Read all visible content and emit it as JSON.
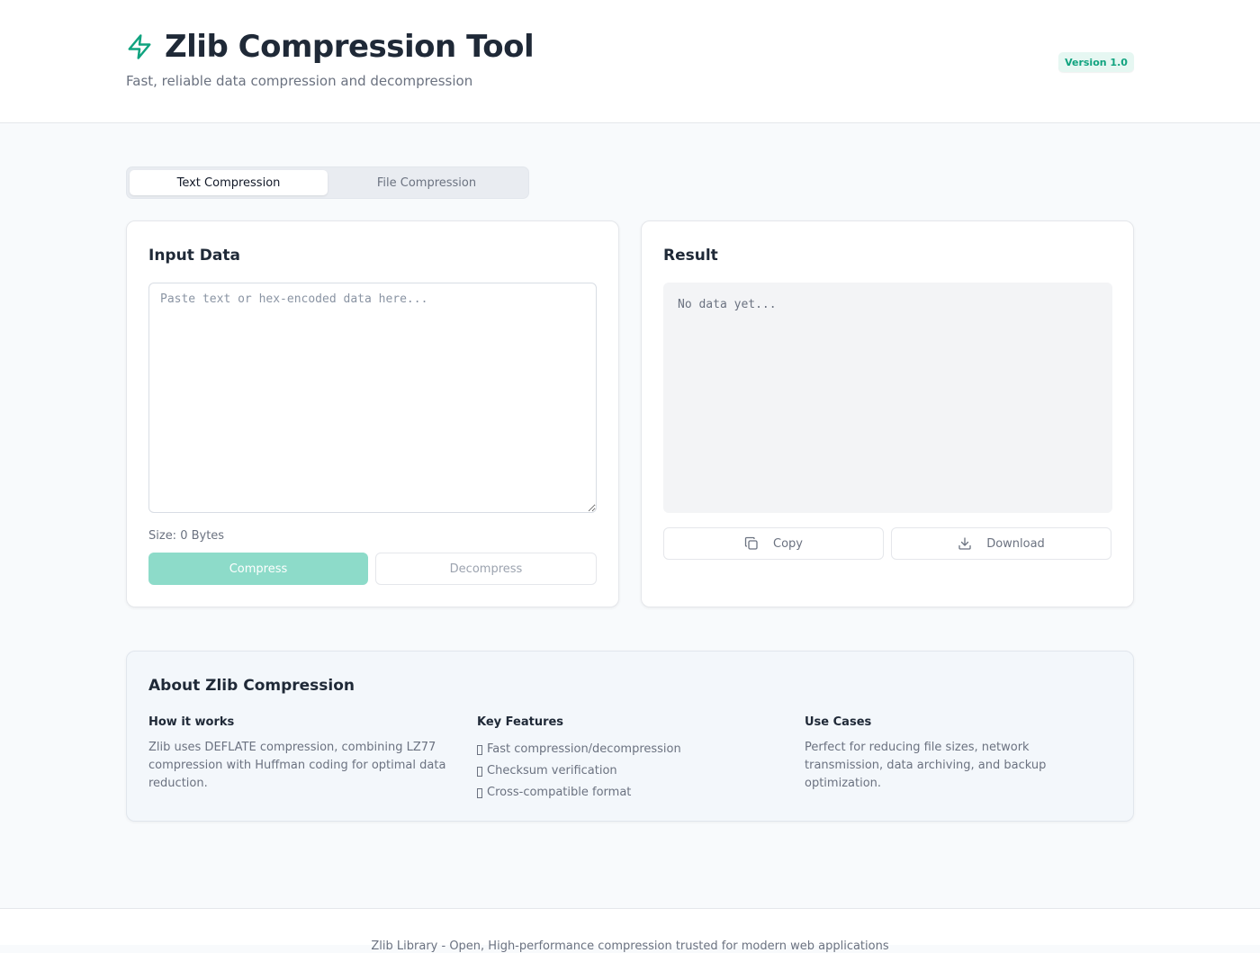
{
  "header": {
    "title": "Zlib Compression Tool",
    "subtitle": "Fast, reliable data compression and decompression",
    "version_badge": "Version 1.0",
    "brand_icon": "lightning-bolt-icon"
  },
  "tabs": [
    {
      "label": "Text Compression",
      "active": true
    },
    {
      "label": "File Compression",
      "active": false
    }
  ],
  "input_card": {
    "title": "Input Data",
    "placeholder": "Paste text or hex-encoded data here...",
    "value": "",
    "size_label": "Size: 0 Bytes",
    "compress_label": "Compress",
    "decompress_label": "Decompress"
  },
  "result_card": {
    "title": "Result",
    "empty_text": "No data yet...",
    "copy_label": "Copy",
    "copy_icon": "copy-icon",
    "download_label": "Download",
    "download_icon": "download-icon"
  },
  "about": {
    "title": "About Zlib Compression",
    "how_it_works": {
      "title": "How it works",
      "text": "Zlib uses DEFLATE compression, combining LZ77 compression with Huffman coding for optimal data reduction."
    },
    "key_features": {
      "title": "Key Features",
      "items": [
        "Fast compression/decompression",
        "Checksum verification",
        "Cross-compatible format"
      ]
    },
    "use_cases": {
      "title": "Use Cases",
      "text": "Perfect for reducing file sizes, network transmission, data archiving, and backup optimization."
    }
  },
  "footer": {
    "text": "Zlib Library - Open, High-performance compression trusted for modern web applications"
  },
  "colors": {
    "accent": "#10a37f",
    "accent_light": "#8ddbc9",
    "badge_bg": "#e6f7f2"
  }
}
